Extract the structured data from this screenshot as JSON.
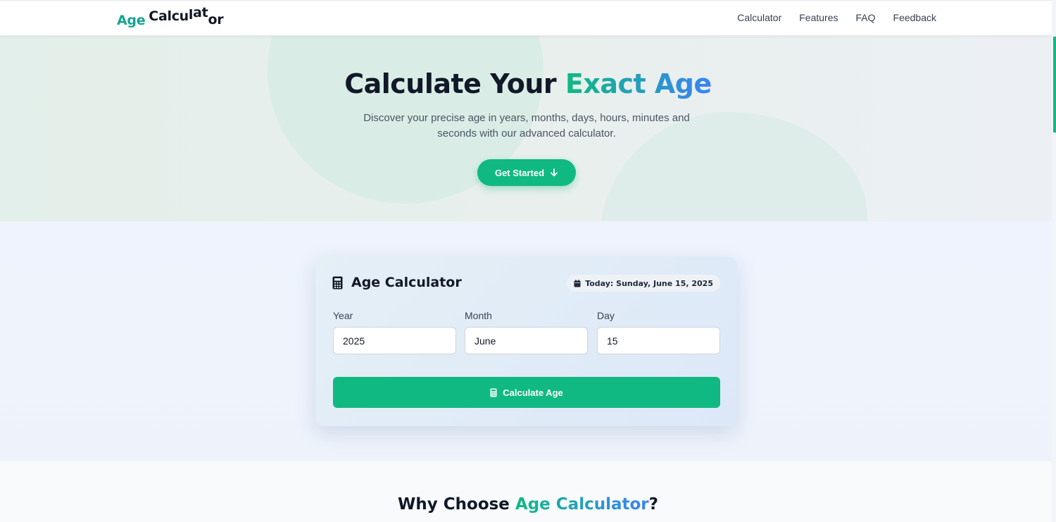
{
  "nav": {
    "logo_age": "Age",
    "logo_calc_chars": [
      "C",
      "a",
      "l",
      "c",
      "u",
      "l",
      "a",
      "t",
      "o",
      "r"
    ],
    "links": [
      "Calculator",
      "Features",
      "FAQ",
      "Feedback"
    ]
  },
  "hero": {
    "title_plain": "Calculate Your ",
    "title_highlight": "Exact Age",
    "subtitle": "Discover your precise age in years, months, days, hours, minutes and seconds with our advanced calculator.",
    "cta_label": "Get Started"
  },
  "calculator": {
    "title": "Age Calculator",
    "today_label": "Today: Sunday, June 15, 2025",
    "fields": {
      "year": {
        "label": "Year",
        "value": "2025"
      },
      "month": {
        "label": "Month",
        "value": "June"
      },
      "day": {
        "label": "Day",
        "value": "15"
      }
    },
    "submit_label": "Calculate Age"
  },
  "features": {
    "title_plain_start": "Why Choose ",
    "title_highlight": "Age Calculator",
    "title_plain_end": "?"
  },
  "colors": {
    "accent_green": "#10b981",
    "accent_blue": "#3b82f6",
    "logo_teal": "#16a391"
  }
}
